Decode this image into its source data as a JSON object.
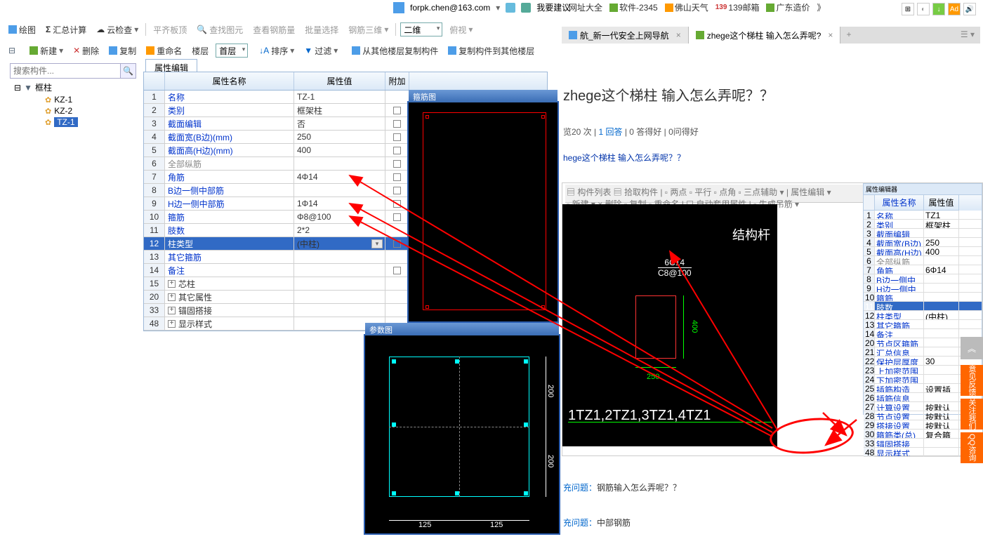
{
  "user": {
    "email": "forpk.chen@163.com",
    "suggest": "我要建议"
  },
  "toplinks": [
    "网址大全",
    "软件-2345",
    "佛山天气",
    "139邮箱",
    "广东造价",
    "》"
  ],
  "toolbar1": {
    "draw": "绘图",
    "sum": "汇总计算",
    "cloud": "云检查",
    "flat": "平齐板顶",
    "find": "查找图元",
    "rebar": "查看钢筋量",
    "batch": "批量选择",
    "rebar3d": "钢筋三维",
    "view2d": "二维",
    "look": "俯视"
  },
  "toolbar2": {
    "new": "新建",
    "del": "删除",
    "copy": "复制",
    "rename": "重命名",
    "floor": "楼层",
    "first": "首层",
    "sort": "排序",
    "filter": "过滤",
    "copyfrom": "从其他楼层复制构件",
    "copyto": "复制构件到其他楼层"
  },
  "search_placeholder": "搜索构件...",
  "tree": {
    "root": "框柱",
    "kz1": "KZ-1",
    "kz2": "KZ-2",
    "tz1": "TZ-1"
  },
  "prop_tab": "属性编辑",
  "headers": {
    "name": "属性名称",
    "value": "属性值",
    "add": "附加"
  },
  "rows": [
    {
      "n": "1",
      "name": "名称",
      "val": "TZ-1",
      "link": true
    },
    {
      "n": "2",
      "name": "类别",
      "val": "框架柱",
      "link": true,
      "cb": true
    },
    {
      "n": "3",
      "name": "截面编辑",
      "val": "否",
      "link": true,
      "cb": true
    },
    {
      "n": "4",
      "name": "截面宽(B边)(mm)",
      "val": "250",
      "link": true,
      "cb": true
    },
    {
      "n": "5",
      "name": "截面高(H边)(mm)",
      "val": "400",
      "link": true,
      "cb": true
    },
    {
      "n": "6",
      "name": "全部纵筋",
      "val": "",
      "gray": true,
      "cb": true
    },
    {
      "n": "7",
      "name": "角筋",
      "val": "4Φ14",
      "link": true,
      "cb": true
    },
    {
      "n": "8",
      "name": "B边一侧中部筋",
      "val": "",
      "link": true,
      "cb": true
    },
    {
      "n": "9",
      "name": "H边一侧中部筋",
      "val": "1Φ14",
      "link": true,
      "cb": true
    },
    {
      "n": "10",
      "name": "箍筋",
      "val": "Φ8@100",
      "link": true,
      "cb": true
    },
    {
      "n": "11",
      "name": "肢数",
      "val": "2*2",
      "link": true
    },
    {
      "n": "12",
      "name": "柱类型",
      "val": "(中柱)",
      "link": true,
      "cb": true,
      "sel": true,
      "dd": true
    },
    {
      "n": "13",
      "name": "其它箍筋",
      "val": "",
      "link": true
    },
    {
      "n": "14",
      "name": "备注",
      "val": "",
      "link": true,
      "cb": true
    },
    {
      "n": "15",
      "name": "芯柱",
      "val": "",
      "expand": true
    },
    {
      "n": "20",
      "name": "其它属性",
      "val": "",
      "expand": true
    },
    {
      "n": "33",
      "name": "锚固搭接",
      "val": "",
      "expand": true
    },
    {
      "n": "48",
      "name": "显示样式",
      "val": "",
      "expand": true
    }
  ],
  "cad_top_title": "箍筋图",
  "cad_bottom_title": "参数图",
  "dims": {
    "d125": "125",
    "d200": "200"
  },
  "tabs": {
    "t1": "航_新一代安全上网导航",
    "t2": "zhege这个梯柱 输入怎么弄呢?"
  },
  "web": {
    "title": "zhege这个梯柱 输入怎么弄呢？？",
    "stats_views": "览20 次",
    "stats_ans": "1 回答",
    "stats_good": "0 答得好",
    "stats_ask": "0问得好",
    "subtitle": "hege这个梯柱 输入怎么弄呢？？",
    "struct": "结构杆",
    "rebar1": "6C14",
    "rebar2": "C8@100",
    "d400": "400",
    "d250": "250",
    "tz": "1TZ1,2TZ1,3TZ1,4TZ1",
    "q1_lbl": "充问题：",
    "q1": "钢筋输入怎么弄呢？？",
    "q2_lbl": "充问题：",
    "q2": "中部钢筋"
  },
  "sr_header_title": "属性编辑器",
  "sr_rows": [
    {
      "n": "1",
      "a": "名称",
      "b": "TZ1"
    },
    {
      "n": "2",
      "a": "类别",
      "b": "框架柱"
    },
    {
      "n": "3",
      "a": "截面编辑",
      "b": ""
    },
    {
      "n": "4",
      "a": "截面宽(B边)",
      "b": "250"
    },
    {
      "n": "5",
      "a": "截面高(H边)",
      "b": "400"
    },
    {
      "n": "6",
      "a": "全部纵筋",
      "b": "",
      "gray": true
    },
    {
      "n": "7",
      "a": "角筋",
      "b": "6Φ14"
    },
    {
      "n": "8",
      "a": "B边一侧中部筋",
      "b": ""
    },
    {
      "n": "9",
      "a": "H边一侧中部筋",
      "b": ""
    },
    {
      "n": "10",
      "a": "箍筋",
      "b": ""
    },
    {
      "n": "11",
      "a": "肢数",
      "b": "",
      "hl": true
    },
    {
      "n": "12",
      "a": "柱类型",
      "b": "(中柱)"
    },
    {
      "n": "13",
      "a": "其它箍筋",
      "b": ""
    },
    {
      "n": "14",
      "a": "备注",
      "b": ""
    },
    {
      "n": "20",
      "a": "节点区箍筋",
      "b": ""
    },
    {
      "n": "21",
      "a": "汇总信息",
      "b": ""
    },
    {
      "n": "22",
      "a": "保护层厚度(mm)",
      "b": "30"
    },
    {
      "n": "23",
      "a": "上加密范围(mm)",
      "b": ""
    },
    {
      "n": "24",
      "a": "下加密范围(mm)",
      "b": ""
    },
    {
      "n": "25",
      "a": "插筋构造",
      "b": "设置插筋"
    },
    {
      "n": "26",
      "a": "插筋信息",
      "b": ""
    },
    {
      "n": "27",
      "a": "计算设置",
      "b": "按默认计算设置计算"
    },
    {
      "n": "28",
      "a": "节点设置",
      "b": "按默认节点设置计算"
    },
    {
      "n": "29",
      "a": "搭接设置",
      "b": "按默认搭接设置计算"
    },
    {
      "n": "30",
      "a": "箍筋类(总)",
      "b": "复合箍"
    },
    {
      "n": "33",
      "a": "锚固搭接",
      "b": ""
    },
    {
      "n": "48",
      "a": "显示样式",
      "b": ""
    }
  ],
  "side": {
    "up": "︽",
    "fb": "意见反馈",
    "follow": "关注我们",
    "qq": "QQ咨询"
  }
}
